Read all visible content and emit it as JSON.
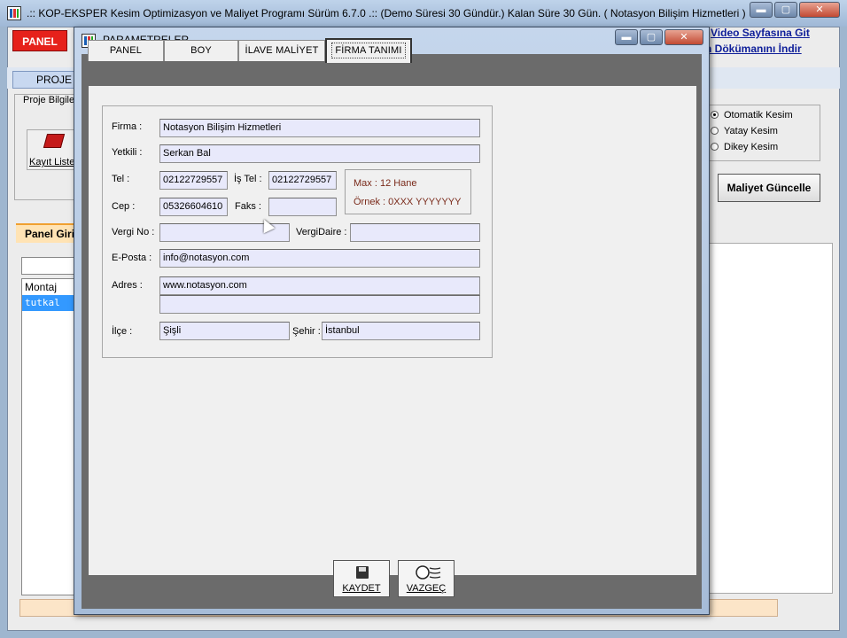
{
  "main_window": {
    "title": ".:: KOP-EKSPER Kesim Optimizasyon ve Maliyet Programı Sürüm 6.7.0 .:: (Demo Süresi 30 Gündür.)  Kalan Süre 30 Gün.  ( Notasyon Bilişim Hizmetleri )",
    "panel_badge": "PANEL",
    "video_link": "Video Sayfasına Git",
    "doc_link": "n Dökümanını İndir",
    "proje_tab": "PROJE",
    "proje_group_label": "Proje Bilgile",
    "kayit_button": "Kayıt Liste",
    "panel_giris_tab": "Panel Giri",
    "left_list": [
      "Montaj",
      "tutkal"
    ],
    "radios": [
      {
        "label": "Otomatik Kesim",
        "selected": true
      },
      {
        "label": "Yatay Kesim",
        "selected": false
      },
      {
        "label": "Dikey Kesim",
        "selected": false
      }
    ],
    "maliyet_button": "Maliyet Güncelle",
    "controls": {
      "minimize": "▬",
      "maximize": "▢",
      "close": "✕"
    }
  },
  "dialog": {
    "title": "PARAMETRELER",
    "controls": {
      "minimize": "▬",
      "maximize": "▢",
      "close": "✕"
    },
    "tabs": [
      {
        "label": "PANEL",
        "active": false
      },
      {
        "label": "BOY",
        "active": false
      },
      {
        "label": "İLAVE MALİYET",
        "active": false
      },
      {
        "label": "FİRMA TANIMI",
        "active": true
      }
    ],
    "form": {
      "firma_label": "Firma :",
      "firma_value": "Notasyon Bilişim Hizmetleri",
      "yetkili_label": "Yetkili :",
      "yetkili_value": "Serkan Bal",
      "tel_label": "Tel :",
      "tel_value": "02122729557",
      "is_tel_label": "İş Tel :",
      "is_tel_value": "02122729557",
      "cep_label": "Cep :",
      "cep_value": "05326604610",
      "faks_label": "Faks :",
      "faks_value": "",
      "hint_max": "Max : 12 Hane",
      "hint_ornek": "Örnek : 0XXX YYYYYYY",
      "vergi_no_label": "Vergi No :",
      "vergi_no_value": "",
      "vergi_daire_label": "VergiDaire :",
      "vergi_daire_value": "",
      "eposta_label": "E-Posta :",
      "eposta_value": "info@notasyon.com",
      "adres_label": "Adres :",
      "adres_line1": "www.notasyon.com",
      "adres_line2": "",
      "ilce_label": "İlçe :",
      "ilce_value": "Şişli",
      "sehir_label": "Şehir :",
      "sehir_value": "İstanbul"
    },
    "buttons": {
      "save": "KAYDET",
      "cancel": "VAZGEÇ"
    }
  }
}
